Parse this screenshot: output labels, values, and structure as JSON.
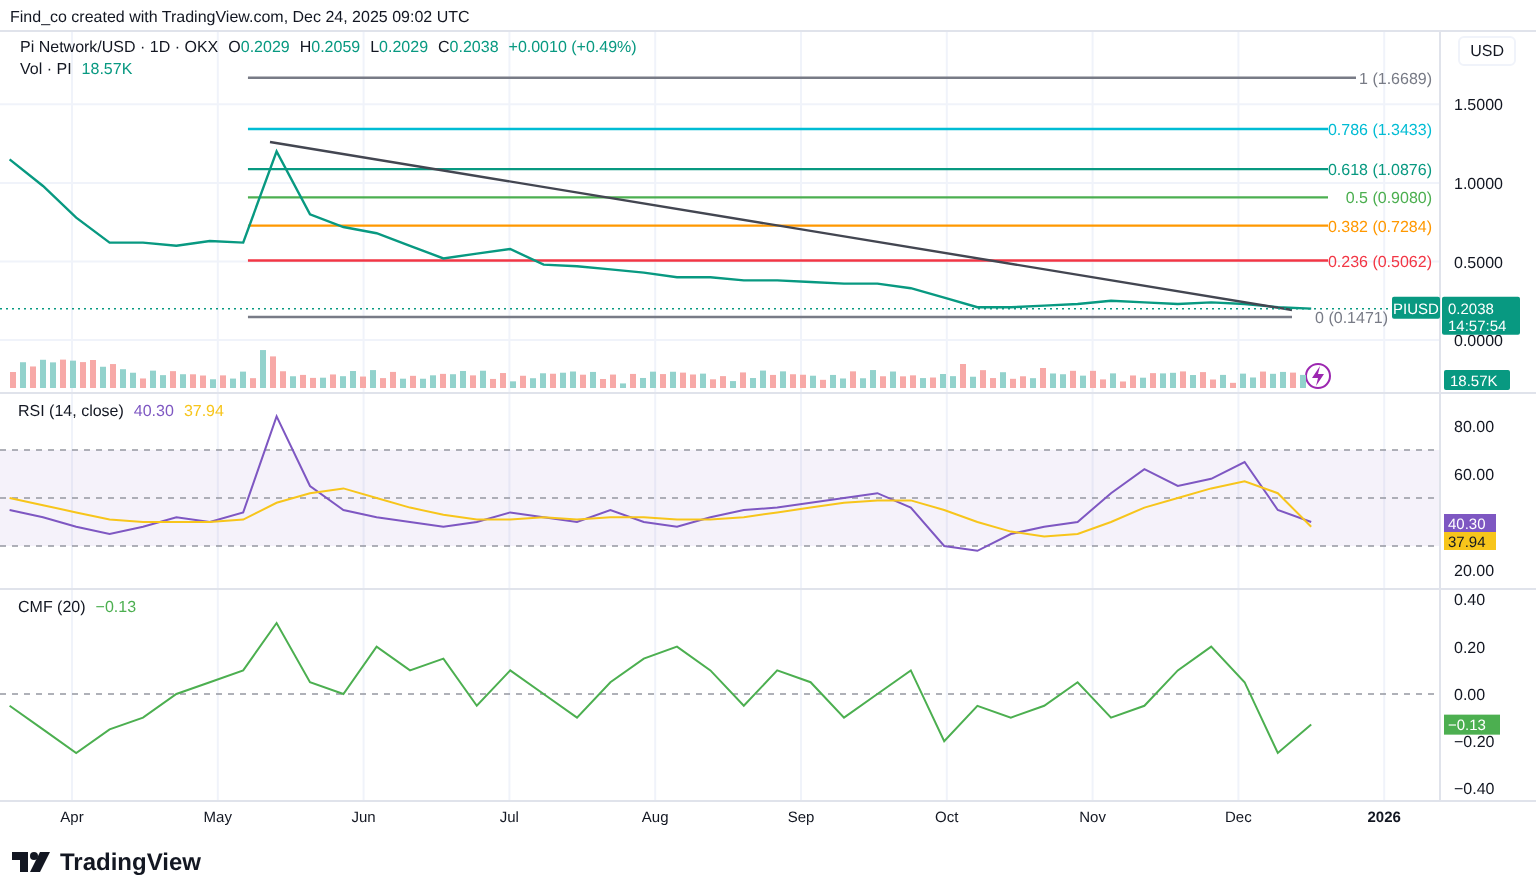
{
  "credit": "Find_co created with TradingView.com, Dec 24, 2025 09:02 UTC",
  "legend": {
    "symbol": "Pi Network/USD · 1D · OKX",
    "ohlc": [
      {
        "label": "O",
        "value": "0.2029"
      },
      {
        "label": "H",
        "value": "0.2059"
      },
      {
        "label": "L",
        "value": "0.2029"
      },
      {
        "label": "C",
        "value": "0.2038"
      }
    ],
    "change": "+0.0010 (+0.49%)",
    "volume_label": "Vol · PI",
    "volume_value": "18.57K"
  },
  "currency": "USD",
  "price_chart": {
    "chart_data": {
      "type": "line",
      "grid": true,
      "ylim": [
        -0.33,
        1.96
      ],
      "categories": [
        null,
        null,
        null,
        null,
        null,
        null,
        null,
        null,
        null,
        null,
        null,
        null,
        null,
        null,
        null,
        null,
        null,
        null,
        null,
        null,
        null,
        null,
        null,
        null,
        null,
        null,
        null,
        null,
        null,
        null,
        null,
        null,
        null,
        null,
        null,
        null,
        null,
        null,
        null,
        null
      ],
      "series": [
        {
          "color": "#089981",
          "values": [
            1.15,
            0.98,
            0.78,
            0.62,
            0.62,
            0.6,
            0.63,
            0.62,
            1.2,
            0.8,
            0.72,
            0.68,
            0.6,
            0.52,
            0.55,
            0.58,
            0.48,
            0.47,
            0.45,
            0.43,
            0.4,
            0.4,
            0.38,
            0.38,
            0.37,
            0.36,
            0.36,
            0.33,
            0.27,
            0.21,
            0.21,
            0.22,
            0.23,
            0.25,
            0.24,
            0.23,
            0.24,
            0.23,
            0.21,
            0.2
          ]
        }
      ],
      "yticks": [
        {
          "value": 1.5,
          "label": "1.5000"
        },
        {
          "value": 1,
          "label": "1.0000"
        },
        {
          "value": 0.5,
          "label": "0.5000"
        },
        {
          "value": 0,
          "label": "0.0000"
        }
      ],
      "ref_lines": [
        {
          "axis": "y",
          "value": 1.6689,
          "label": "1 (1.6689)",
          "color": "#787b86"
        },
        {
          "axis": "y",
          "value": 1.3433,
          "label": "0.786 (1.3433)",
          "color": "#00bcd4"
        },
        {
          "axis": "y",
          "value": 1.0876,
          "label": "0.618 (1.0876)",
          "color": "#089981"
        },
        {
          "axis": "y",
          "value": 0.908,
          "label": "0.5 (0.9080)",
          "color": "#4caf50"
        },
        {
          "axis": "y",
          "value": 0.7284,
          "label": "0.382 (0.7284)",
          "color": "#ff9800"
        },
        {
          "axis": "y",
          "value": 0.5062,
          "label": "0.236 (0.5062)",
          "color": "#f23645"
        },
        {
          "axis": "y",
          "value": 0.1471,
          "label": "0 (0.1471)",
          "color": "#787b86"
        }
      ]
    },
    "symbol_tag": "PIUSD",
    "price_tag": "0.2038",
    "countdown": "14:57:54",
    "volume_tag": "18.57K"
  },
  "rsi": {
    "title": "RSI (14, close)",
    "legend_readings": [
      "40.30",
      "37.94"
    ],
    "tag_readings": [
      "40.30",
      "37.94"
    ],
    "chart_data": {
      "type": "line",
      "grid": true,
      "ylim": [
        12.5,
        93.3
      ],
      "categories": [
        null,
        null,
        null,
        null,
        null,
        null,
        null,
        null,
        null,
        null,
        null,
        null,
        null,
        null,
        null,
        null,
        null,
        null,
        null,
        null,
        null,
        null,
        null,
        null,
        null,
        null,
        null,
        null,
        null,
        null,
        null,
        null,
        null,
        null,
        null,
        null,
        null,
        null,
        null,
        null
      ],
      "series": [
        {
          "color": "#7e57c2",
          "values": [
            45,
            42,
            38,
            35,
            38,
            42,
            40,
            44,
            84,
            55,
            45,
            42,
            40,
            38,
            40,
            44,
            42,
            40,
            45,
            40,
            38,
            42,
            45,
            46,
            48,
            50,
            52,
            46,
            30,
            28,
            35,
            38,
            40,
            52,
            62,
            55,
            58,
            65,
            45,
            40
          ]
        },
        {
          "color": "#f7c51b",
          "values": [
            50,
            47,
            44,
            41,
            40,
            40,
            40,
            41,
            48,
            52,
            54,
            50,
            46,
            43,
            41,
            41,
            42,
            41,
            42,
            42,
            41,
            41,
            42,
            44,
            46,
            48,
            49,
            49,
            45,
            40,
            36,
            34,
            35,
            40,
            46,
            50,
            54,
            57,
            52,
            38
          ]
        }
      ],
      "bands": [
        {
          "axis": "y",
          "from": 30,
          "to": 70,
          "color": "#7e57c2"
        }
      ],
      "ref_lines": [
        {
          "axis": "y",
          "value": 70,
          "color": "#9598a1"
        },
        {
          "axis": "y",
          "value": 50,
          "color": "#9598a1"
        },
        {
          "axis": "y",
          "value": 30,
          "color": "#9598a1"
        }
      ],
      "yticks": [
        {
          "value": 80,
          "label": "80.00"
        },
        {
          "value": 60,
          "label": "60.00"
        },
        {
          "value": 20,
          "label": "20.00"
        }
      ]
    }
  },
  "cmf": {
    "title": "CMF (20)",
    "legend_reading": "−0.13",
    "tag_reading": "−0.13",
    "chart_data": {
      "type": "line",
      "grid": true,
      "ylim": [
        -0.449,
        0.44
      ],
      "categories": [
        null,
        null,
        null,
        null,
        null,
        null,
        null,
        null,
        null,
        null,
        null,
        null,
        null,
        null,
        null,
        null,
        null,
        null,
        null,
        null,
        null,
        null,
        null,
        null,
        null,
        null,
        null,
        null,
        null,
        null,
        null,
        null,
        null,
        null,
        null,
        null,
        null,
        null,
        null,
        null
      ],
      "ref_lines": [
        {
          "axis": "y",
          "value": 0,
          "color": "#9598a1"
        }
      ],
      "series": [
        {
          "color": "#4caf50",
          "values": [
            -0.05,
            -0.15,
            -0.25,
            -0.15,
            -0.1,
            0,
            0.05,
            0.1,
            0.3,
            0.05,
            0,
            0.2,
            0.1,
            0.15,
            -0.05,
            0.1,
            0,
            -0.1,
            0.05,
            0.15,
            0.2,
            0.1,
            -0.05,
            0.1,
            0.05,
            -0.1,
            0,
            0.1,
            -0.2,
            -0.05,
            -0.1,
            -0.05,
            0.05,
            -0.1,
            -0.05,
            0.1,
            0.2,
            0.05,
            -0.25,
            -0.13
          ]
        }
      ],
      "yticks": [
        {
          "value": 0.4,
          "label": "0.40"
        },
        {
          "value": 0.2,
          "label": "0.20"
        },
        {
          "value": 0,
          "label": "0.00"
        },
        {
          "value": -0.2,
          "label": "−0.20"
        },
        {
          "value": -0.4,
          "label": "−0.40"
        }
      ]
    }
  },
  "time_axis": [
    {
      "label": "Apr",
      "kind": "month"
    },
    {
      "label": "May",
      "kind": "month"
    },
    {
      "label": "Jun",
      "kind": "month"
    },
    {
      "label": "Jul",
      "kind": "month"
    },
    {
      "label": "Aug",
      "kind": "month"
    },
    {
      "label": "Sep",
      "kind": "month"
    },
    {
      "label": "Oct",
      "kind": "month"
    },
    {
      "label": "Nov",
      "kind": "month"
    },
    {
      "label": "Dec",
      "kind": "month"
    },
    {
      "label": "2026",
      "kind": "year"
    }
  ],
  "brand": "TradingView"
}
